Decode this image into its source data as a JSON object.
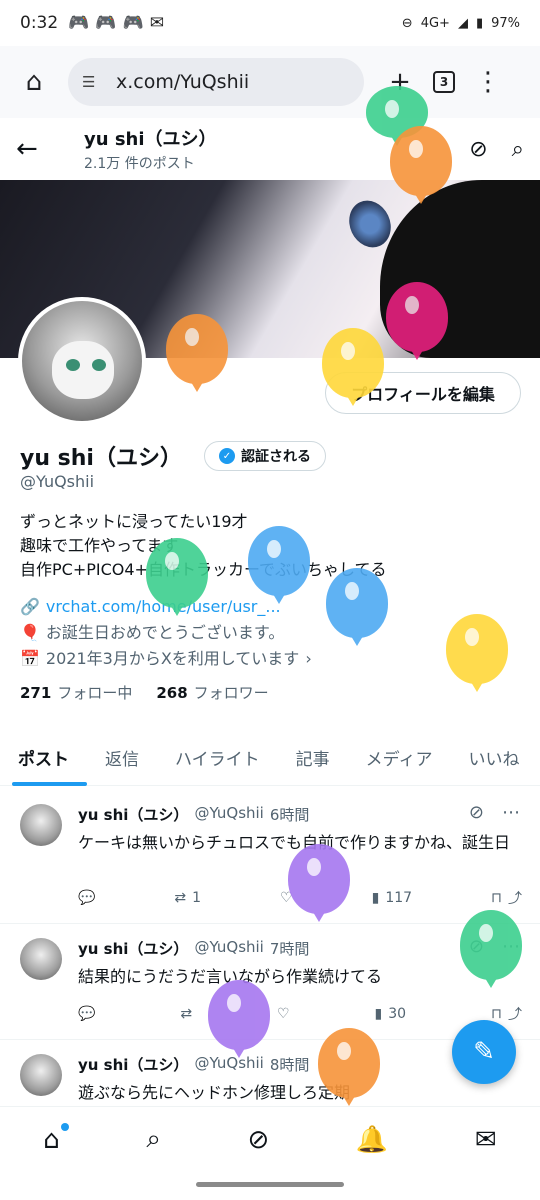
{
  "status": {
    "time": "0:32",
    "signal": "4G+",
    "battery": "97%"
  },
  "browser": {
    "url": "x.com/YuQshii",
    "tab_count": "3"
  },
  "header": {
    "name": "yu shi（ユシ）",
    "post_count": "2.1万 件のポスト"
  },
  "profile": {
    "edit_label": "プロフィールを編集",
    "name": "yu shi（ユシ）",
    "verify_label": "認証される",
    "handle": "@YuQshii",
    "bio": [
      "ずっとネットに浸ってたい19才",
      "趣味で工作やってます",
      "自作PC+PICO4+自作トラッカーでぶいちゃしてる"
    ],
    "link": "vrchat.com/home/user/usr_...",
    "birthday": "お誕生日おめでとうございます。",
    "joined": "2021年3月からXを利用しています",
    "following_count": "271",
    "following_label": "フォロー中",
    "followers_count": "268",
    "followers_label": "フォロワー"
  },
  "tabs": [
    "ポスト",
    "返信",
    "ハイライト",
    "記事",
    "メディア",
    "いいね"
  ],
  "posts": [
    {
      "name": "yu shi（ユシ）",
      "handle": "@YuQshii",
      "time": "6時間",
      "text": "ケーキは無いからチュロスでも自前で作りますかね、誕生日",
      "retweets": "1",
      "views": "117"
    },
    {
      "name": "yu shi（ユシ）",
      "handle": "@YuQshii",
      "time": "7時間",
      "text": "結果的にうだうだ言いながら作業続けてる",
      "retweets": "",
      "views": "30"
    },
    {
      "name": "yu shi（ユシ）",
      "handle": "@YuQshii",
      "time": "8時間",
      "text": "遊ぶなら先にヘッドホン修理しろ定期",
      "retweets": "",
      "views": ""
    }
  ],
  "colors": {
    "accent": "#1d9bf0",
    "text": "#0f1419",
    "muted": "#536471"
  },
  "icons": [
    "home-icon",
    "search-icon",
    "grok-icon",
    "bell-icon",
    "mail-icon",
    "compose-icon"
  ]
}
